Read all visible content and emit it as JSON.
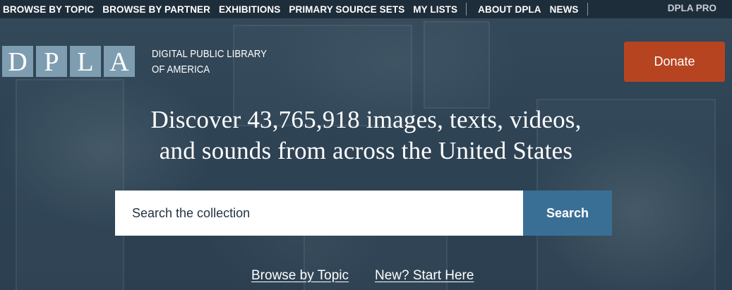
{
  "nav": {
    "items": [
      {
        "label": "BROWSE BY TOPIC"
      },
      {
        "label": "BROWSE BY PARTNER"
      },
      {
        "label": "EXHIBITIONS"
      },
      {
        "label": "PRIMARY SOURCE SETS"
      },
      {
        "label": "MY LISTS"
      }
    ],
    "secondary": [
      {
        "label": "ABOUT DPLA"
      },
      {
        "label": "NEWS"
      }
    ],
    "pro": "DPLA PRO"
  },
  "logo": {
    "letters": [
      "D",
      "P",
      "L",
      "A"
    ],
    "line1": "DIGITAL PUBLIC LIBRARY",
    "line2": "OF AMERICA"
  },
  "donate_label": "Donate",
  "hero": {
    "line1": "Discover 43,765,918 images, texts, videos,",
    "line2": "and sounds from across the United States"
  },
  "search": {
    "placeholder": "Search the collection",
    "button_label": "Search"
  },
  "links": {
    "browse_topic": "Browse by Topic",
    "start_here": "New? Start Here"
  },
  "colors": {
    "nav_bg": "#1e2d3a",
    "hero_bg": "#2d4152",
    "logo_tile": "#7f9db0",
    "donate": "#b74421",
    "search_button": "#3a6f95"
  }
}
